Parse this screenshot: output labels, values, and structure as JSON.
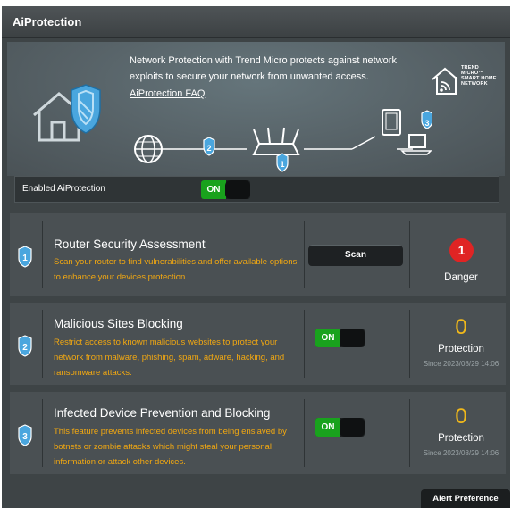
{
  "title": "AiProtection",
  "banner": {
    "description": "Network Protection with Trend Micro protects against network exploits to secure your network from unwanted access.",
    "faq_link": "AiProtection FAQ",
    "trend_logo_text": "TREND MICRO™ SMART HOME NETWORK",
    "step_numbers": [
      "1",
      "2",
      "3"
    ]
  },
  "enable_row": {
    "label": "Enabled AiProtection",
    "toggle_label": "ON"
  },
  "cards": [
    {
      "number": "1",
      "title": "Router Security Assessment",
      "description": "Scan your router to find vulnerabilities and offer available options to enhance your devices protection.",
      "action_label": "Scan",
      "status_value": "1",
      "status_label": "Danger"
    },
    {
      "number": "2",
      "title": "Malicious Sites Blocking",
      "description": "Restrict access to known malicious websites to protect your network from malware, phishing, spam, adware, hacking, and ransomware attacks.",
      "toggle_label": "ON",
      "status_value": "0",
      "status_label": "Protection",
      "status_since": "Since 2023/08/29 14:06"
    },
    {
      "number": "3",
      "title": "Infected Device Prevention and Blocking",
      "description": "This feature prevents infected devices from being enslaved by botnets or zombie attacks which might steal your personal information or attack other devices.",
      "toggle_label": "ON",
      "status_value": "0",
      "status_label": "Protection",
      "status_since": "Since 2023/08/29 14:06"
    }
  ],
  "alert_preference_label": "Alert Preference",
  "colors": {
    "accent_orange": "#f2a811",
    "toggle_green": "#19a21d",
    "danger_red": "#e02424",
    "shield_blue": "#4aa6de"
  },
  "icons": [
    "house-shield-icon",
    "globe-icon",
    "router-icon",
    "tablet-icon",
    "laptop-icon",
    "wifi-home-icon",
    "magnifier-badge-icon"
  ]
}
